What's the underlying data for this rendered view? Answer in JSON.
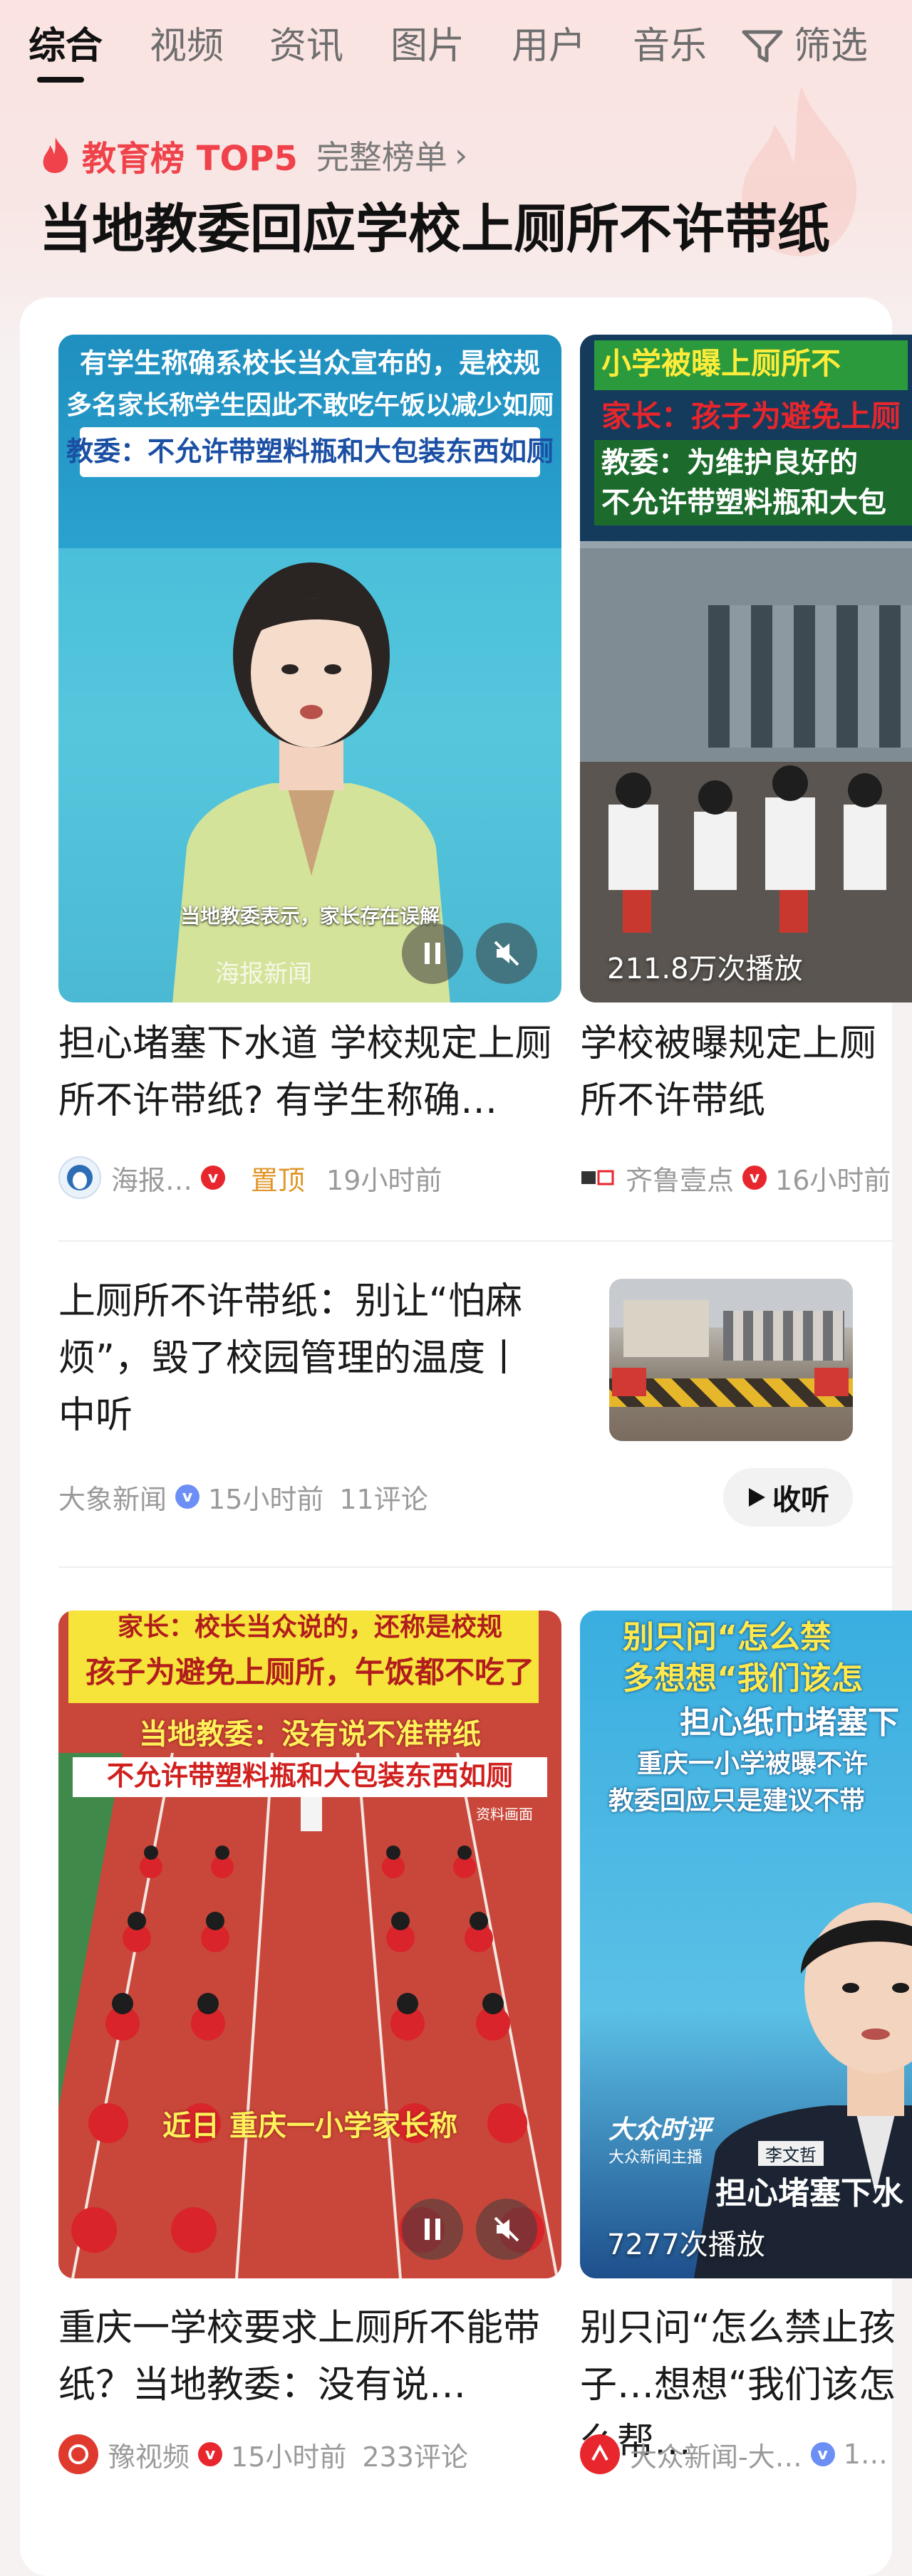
{
  "tabs": [
    {
      "label": "综合",
      "active": true
    },
    {
      "label": "视频"
    },
    {
      "label": "资讯"
    },
    {
      "label": "图片"
    },
    {
      "label": "用户"
    },
    {
      "label": "音乐"
    }
  ],
  "filter_label": "筛选",
  "rank": {
    "title": "教育榜 TOP5",
    "more": "完整榜单",
    "chevron": "›"
  },
  "headline": "当地教委回应学校上厕所不许带纸",
  "videos_row1": [
    {
      "title": "担心堵塞下水道 学校规定上厕所不许带纸? 有学生称确…",
      "author": "海报…",
      "pinned": "置顶",
      "time": "19小时前",
      "captions": [
        "有学生称确系校长当众宣布的，是校规",
        "多名家长称学生因此不敢吃午饭以减少如厕",
        "教委：不允许带塑料瓶和大包装东西如厕"
      ],
      "subtitle": "当地教委表示，家长存在误解",
      "watermark": "海报新闻"
    },
    {
      "title": "学校被曝规定上厕所不许带纸",
      "author": "齐鲁壹点",
      "time": "16小时前",
      "plays": "211.8万次播放",
      "captions": [
        "小学被曝上厕所不",
        "家长：孩子为避免上厕",
        "教委：为维护良好的",
        "不允许带塑料瓶和大包"
      ]
    }
  ],
  "article": {
    "title_lines": [
      "上厕所不许带纸：别让“怕麻",
      "烦”，毁了校园管理的温度丨",
      "中听"
    ],
    "source": "大象新闻",
    "time": "15小时前",
    "comments": "11评论",
    "listen": "收听"
  },
  "videos_row2": [
    {
      "title": "重庆一学校要求上厕所不能带纸？当地教委：没有说…",
      "author": "豫视频",
      "time": "15小时前",
      "comments": "233评论",
      "captions": [
        "家长：校长当众说的，还称是校规",
        "孩子为避免上厕所，午饭都不吃了",
        "当地教委：没有说不准带纸",
        "不允许带塑料瓶和大包装东西如厕"
      ],
      "subtitle": "近日 重庆一小学家长称",
      "tag": "资料画面"
    },
    {
      "title": "别只问“怎么禁止孩子…想想“我们该怎么帮…",
      "author": "大众新闻-大…",
      "time": "1…",
      "plays": "7277次播放",
      "captions": [
        "别只问“怎么禁",
        "多想想“我们该怎",
        "担心纸巾堵塞下",
        "重庆一小学被曝不许",
        "教委回应只是建议不带"
      ],
      "show_name": "大众时评",
      "anchor_role": "大众新闻主播",
      "anchor_name": "李文哲",
      "lower_caption": "担心堵塞下水"
    }
  ],
  "colors": {
    "accent": "#f0424a",
    "pinned": "#e0962a",
    "verified_red": "#e8262d",
    "verified_blue": "#6b8ff5"
  }
}
